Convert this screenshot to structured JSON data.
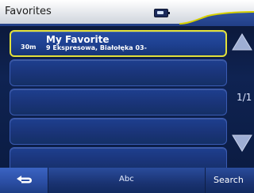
{
  "header": {
    "title": "Favorites",
    "battery_icon": "battery-icon"
  },
  "list": {
    "items": [
      {
        "distance": "30m",
        "name": "My Favorite",
        "address": "9 Ekspresowa, Białołęka 03-"
      },
      {
        "distance": "",
        "name": "",
        "address": ""
      },
      {
        "distance": "",
        "name": "",
        "address": ""
      },
      {
        "distance": "",
        "name": "",
        "address": ""
      },
      {
        "distance": "",
        "name": "",
        "address": ""
      }
    ]
  },
  "pagination": {
    "page_text": "1/1"
  },
  "bottom": {
    "back_icon": "back-arrow-icon",
    "abc_label": "Abc",
    "search_label": "Search"
  },
  "colors": {
    "accent_yellow": "#e2e13a",
    "background_blue": "#0f2352"
  }
}
